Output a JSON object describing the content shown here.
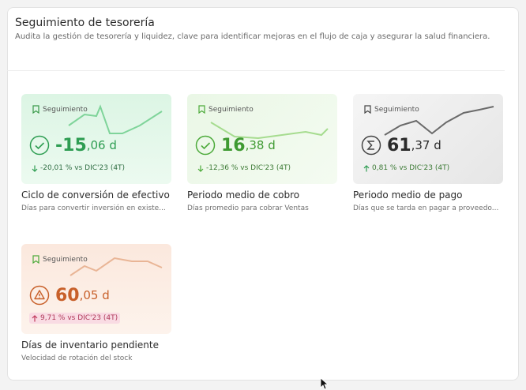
{
  "header": {
    "title": "Seguimiento de tesorería",
    "subtitle": "Audita la gestión de tesorería y liquidez, clave para identificar mejoras en el flujo de caja y asegurar la salud financiera."
  },
  "tag_label": "Seguimiento",
  "cards": [
    {
      "value_int": "-15",
      "value_dec": ",06 d",
      "delta": "-20,01 % vs DIC'23 (4T)",
      "delta_direction": "down",
      "title": "Ciclo de conversión de efectivo",
      "description": "Días para convertir inversión en existe...",
      "status_icon": "check-circle-icon",
      "accent": "#2e9d52"
    },
    {
      "value_int": "16",
      "value_dec": ",38 d",
      "delta": "-12,36 % vs DIC'23 (4T)",
      "delta_direction": "down",
      "title": "Periodo medio de cobro",
      "description": "Días promedio para cobrar Ventas",
      "status_icon": "check-circle-icon",
      "accent": "#4caa3a"
    },
    {
      "value_int": "61",
      "value_dec": ",37 d",
      "delta": "0,81 % vs DIC'23 (4T)",
      "delta_direction": "up",
      "title": "Periodo medio de pago",
      "description": "Días que se tarda en pagar a proveedo...",
      "status_icon": "sigma-icon",
      "accent": "#2b2b2b"
    },
    {
      "value_int": "60",
      "value_dec": ",05 d",
      "delta": "9,71 % vs DIC'23 (4T)",
      "delta_direction": "up",
      "title": "Días de inventario pendiente",
      "description": "Velocidad de rotación del stock",
      "status_icon": "warning-triangle-icon",
      "accent": "#d06a34"
    }
  ]
}
